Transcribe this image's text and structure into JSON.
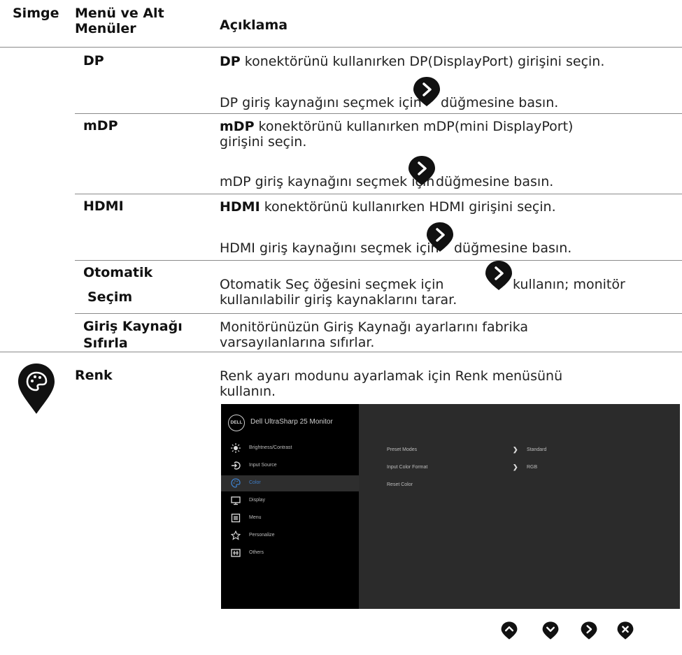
{
  "header": {
    "col_icon": "Simge",
    "col_menu_line1": "Menü ve Alt",
    "col_menu_line2": "Menüler",
    "col_desc": "Açıklama"
  },
  "rows": {
    "dp": {
      "label": "DP",
      "desc1_bold": "DP",
      "desc1_rest": " konektörünü kullanırken DP(DisplayPort) girişini seçin.",
      "desc2_pre": "DP giriş kaynağını seçmek için ",
      "desc2_post": " düğmesine basın."
    },
    "mdp": {
      "label": "mDP",
      "desc1_bold": "mDP",
      "desc1_rest": " konektörünü kullanırken mDP(mini DisplayPort)",
      "desc1_line2": "girişini seçin.",
      "desc2_pre": "mDP giriş kaynağını seçmek için ",
      "desc2_post": " düğmesine basın."
    },
    "hdmi": {
      "label": "HDMI",
      "desc1_bold": "HDMI",
      "desc1_rest": " konektörünü kullanırken HDMI girişini seçin.",
      "desc2_pre": "HDMI giriş kaynağını seçmek için ",
      "desc2_post": " düğmesine basın."
    },
    "auto": {
      "label_line1": "Otomatik",
      "label_line2": "Seçim",
      "desc_pre": "Otomatik Seç öğesini seçmek için ",
      "desc_post": " kullanın; monitör",
      "desc_line2": "kullanılabilir giriş kaynaklarını tarar."
    },
    "reset": {
      "label_line1": "Giriş Kaynağı",
      "label_line2": "Sıfırla",
      "desc_line1": "Monitörünüzün Giriş Kaynağı ayarlarını fabrika",
      "desc_line2": "varsayılanlarına sıfırlar."
    },
    "color": {
      "label": "Renk",
      "icon": "color-palette-pin-icon",
      "desc_line1": "Renk ayarı modunu ayarlamak için Renk menüsünü",
      "desc_line2": "kullanın."
    }
  },
  "osd": {
    "logo": "DELL",
    "title": "Dell UltraSharp 25 Monitor",
    "menu": [
      {
        "label": "Brightness/Contrast",
        "icon": "sun-icon"
      },
      {
        "label": "Input Source",
        "icon": "input-icon"
      },
      {
        "label": "Color",
        "icon": "palette-icon"
      },
      {
        "label": "Display",
        "icon": "monitor-icon"
      },
      {
        "label": "Menu",
        "icon": "menu-list-icon"
      },
      {
        "label": "Personalize",
        "icon": "star-icon"
      },
      {
        "label": "Others",
        "icon": "others-icon"
      }
    ],
    "selected_index": 2,
    "settings": [
      {
        "label": "Preset Modes",
        "value": "Standard",
        "arrow": true
      },
      {
        "label": "Input Color Format",
        "value": "RGB",
        "arrow": true
      },
      {
        "label": "Reset Color",
        "value": "",
        "arrow": false
      }
    ],
    "colors": {
      "accent": "#3e7ec8",
      "panel": "#2b2b2b",
      "sidebar": "#000000"
    }
  },
  "nav_buttons": [
    "up-pin-icon",
    "down-pin-icon",
    "right-pin-icon",
    "close-pin-icon"
  ]
}
